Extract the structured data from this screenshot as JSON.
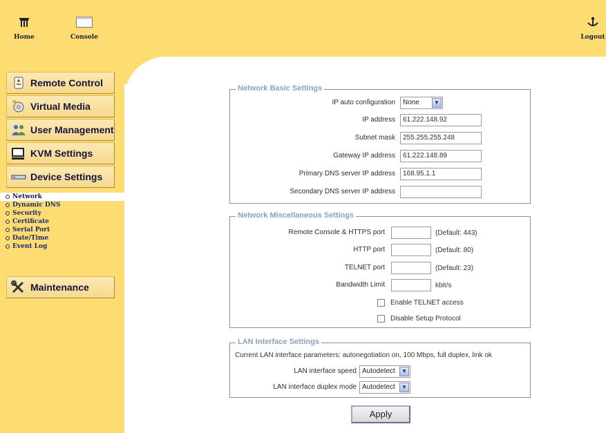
{
  "toolbar": {
    "home_label": "Home",
    "console_label": "Console",
    "logout_label": "Logout"
  },
  "sidebar": {
    "remote_control": "Remote Control",
    "virtual_media": "Virtual Media",
    "user_management": "User Management",
    "kvm_settings": "KVM Settings",
    "device_settings": "Device Settings",
    "maintenance": "Maintenance",
    "sub_items": [
      "Network",
      "Dynamic DNS",
      "Security",
      "Certificate",
      "Serial Port",
      "Date/Time",
      "Event Log"
    ]
  },
  "basic": {
    "legend": "Network Basic Settings",
    "ip_auto_label": "IP auto configuration",
    "ip_auto_value": "None",
    "ip_label": "IP address",
    "ip_value": "61.222.148.92",
    "mask_label": "Subnet mask",
    "mask_value": "255.255.255.248",
    "gateway_label": "Gateway IP address",
    "gateway_value": "61.222.148.89",
    "dns1_label": "Primary DNS server IP address",
    "dns1_value": "168.95.1.1",
    "dns2_label": "Secondary DNS server IP address",
    "dns2_value": ""
  },
  "misc": {
    "legend": "Network Miscellaneous Settings",
    "https_label": "Remote Console & HTTPS port",
    "https_value": "",
    "https_hint": "(Default: 443)",
    "http_label": "HTTP port",
    "http_value": "",
    "http_hint": "(Default: 80)",
    "telnet_label": "TELNET port",
    "telnet_value": "",
    "telnet_hint": "(Default: 23)",
    "bw_label": "Bandwidth Limit",
    "bw_value": "",
    "bw_unit": "kbit/s",
    "enable_telnet": "Enable TELNET access",
    "disable_setup": "Disable Setup Protocol"
  },
  "lan": {
    "legend": "LAN Interface Settings",
    "current_params": "Current LAN interface parameters:  autonegotiation on, 100 Mbps, full duplex, link ok",
    "speed_label": "LAN interface speed",
    "speed_value": "Autodetect",
    "duplex_label": "LAN interface duplex mode",
    "duplex_value": "Autodetect"
  },
  "apply_label": "Apply"
}
